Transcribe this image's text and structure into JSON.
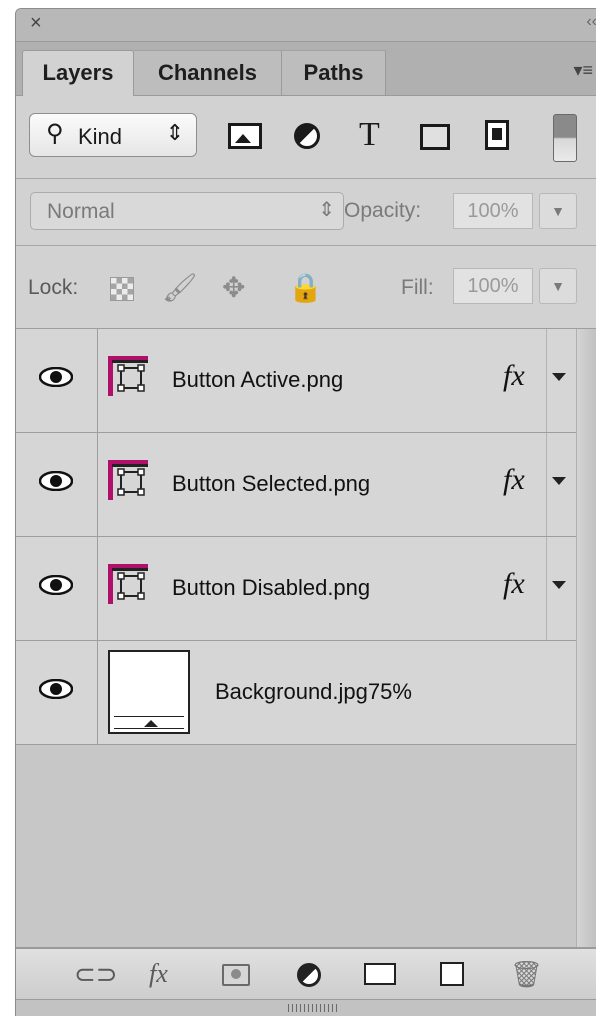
{
  "panel": {
    "close_icon": "close-icon",
    "collapse_icon": "collapse-arrows-icon",
    "tabs": [
      {
        "label": "Layers",
        "active": true
      },
      {
        "label": "Channels",
        "active": false
      },
      {
        "label": "Paths",
        "active": false
      }
    ],
    "menu_icon": "panel-menu-icon"
  },
  "filter": {
    "kind_label": "Kind",
    "kind_icon": "search-icon",
    "filters": [
      "image-filter-icon",
      "adjustment-filter-icon",
      "type-filter-icon",
      "shape-filter-icon",
      "smart-object-filter-icon"
    ],
    "type_glyph": "T",
    "toggle_icon": "filter-toggle-icon"
  },
  "blend": {
    "mode": "Normal",
    "opacity_label": "Opacity:",
    "opacity_value": "100%"
  },
  "lock": {
    "label": "Lock:",
    "fill_label": "Fill:",
    "fill_value": "100%"
  },
  "layers": [
    {
      "name": "Button Active.png",
      "type": "smart-object",
      "fx": "fx",
      "visible": true
    },
    {
      "name": "Button Selected.png",
      "type": "smart-object",
      "fx": "fx",
      "visible": true
    },
    {
      "name": "Button Disabled.png",
      "type": "smart-object",
      "fx": "fx",
      "visible": true
    },
    {
      "name": "Background.jpg75%",
      "type": "raster",
      "fx": "",
      "visible": true
    }
  ],
  "toolbar": {
    "icons": [
      "link-layers-icon",
      "layer-style-icon",
      "layer-mask-icon",
      "adjustment-layer-icon",
      "group-folder-icon",
      "new-layer-icon",
      "trash-icon"
    ],
    "fx_glyph": "fx"
  },
  "colors": {
    "smart_object_accent": "#b0106a",
    "panel_bg": "#d2d2d2"
  }
}
